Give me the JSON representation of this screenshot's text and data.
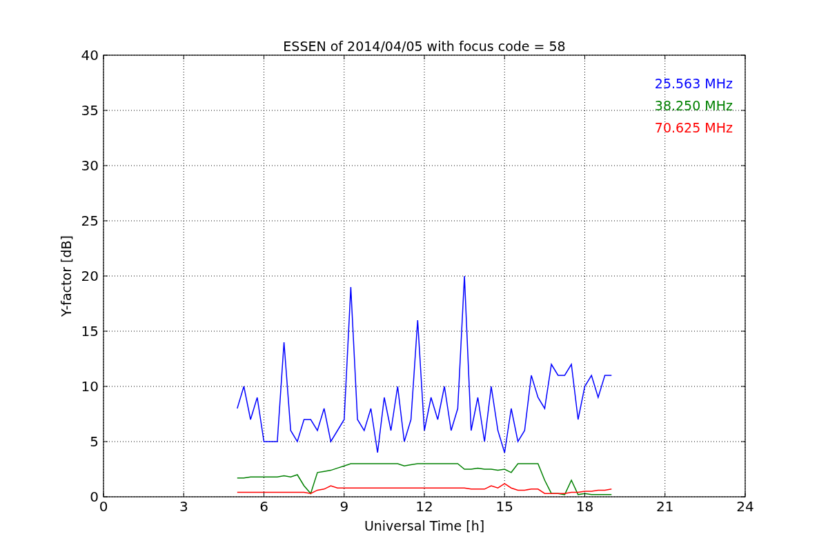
{
  "chart_data": {
    "type": "line",
    "title": "ESSEN of 2014/04/05 with focus code = 58",
    "xlabel": "Universal Time [h]",
    "ylabel": "Y-factor [dB]",
    "x": [
      5,
      5.25,
      5.5,
      5.75,
      6,
      6.25,
      6.5,
      6.75,
      7,
      7.25,
      7.5,
      7.75,
      8,
      8.25,
      8.5,
      8.75,
      9,
      9.25,
      9.5,
      9.75,
      10,
      10.25,
      10.5,
      10.75,
      11,
      11.25,
      11.5,
      11.75,
      12,
      12.25,
      12.5,
      12.75,
      13,
      13.25,
      13.5,
      13.75,
      14,
      14.25,
      14.5,
      14.75,
      15,
      15.25,
      15.5,
      15.75,
      16,
      16.25,
      16.5,
      16.75,
      17,
      17.25,
      17.5,
      17.75,
      18,
      18.25,
      18.5,
      18.75,
      19
    ],
    "series": [
      {
        "name": "25.563 MHz",
        "color": "#0000ff",
        "values": [
          8,
          10,
          7,
          9,
          5,
          5,
          5,
          14,
          6,
          5,
          7,
          7,
          6,
          8,
          5,
          6,
          7,
          19,
          7,
          6,
          8,
          4,
          9,
          6,
          10,
          5,
          7,
          16,
          6,
          9,
          7,
          10,
          6,
          8,
          20,
          6,
          9,
          5,
          10,
          6,
          4,
          8,
          5,
          6,
          11,
          9,
          8,
          12,
          11,
          11,
          12,
          7,
          10,
          11,
          9,
          11,
          11
        ]
      },
      {
        "name": "38.250 MHz",
        "color": "#008000",
        "values": [
          1.7,
          1.7,
          1.8,
          1.8,
          1.8,
          1.8,
          1.8,
          1.9,
          1.8,
          2.0,
          1.0,
          0.3,
          2.2,
          2.3,
          2.4,
          2.6,
          2.8,
          3.0,
          3.0,
          3.0,
          3.0,
          3.0,
          3.0,
          3.0,
          3.0,
          2.8,
          2.9,
          3.0,
          3.0,
          3.0,
          3.0,
          3.0,
          3.0,
          3.0,
          2.5,
          2.5,
          2.6,
          2.5,
          2.5,
          2.4,
          2.5,
          2.2,
          3.0,
          3.0,
          3.0,
          3.0,
          1.5,
          0.3,
          0.3,
          0.2,
          1.5,
          0.2,
          0.3,
          0.2,
          0.2,
          0.2,
          0.2
        ]
      },
      {
        "name": "70.625 MHz",
        "color": "#ff0000",
        "values": [
          0.4,
          0.4,
          0.4,
          0.4,
          0.4,
          0.4,
          0.4,
          0.4,
          0.4,
          0.4,
          0.4,
          0.3,
          0.6,
          0.7,
          1.0,
          0.8,
          0.8,
          0.8,
          0.8,
          0.8,
          0.8,
          0.8,
          0.8,
          0.8,
          0.8,
          0.8,
          0.8,
          0.8,
          0.8,
          0.8,
          0.8,
          0.8,
          0.8,
          0.8,
          0.8,
          0.7,
          0.7,
          0.7,
          1.0,
          0.8,
          1.2,
          0.8,
          0.6,
          0.6,
          0.7,
          0.7,
          0.3,
          0.3,
          0.3,
          0.3,
          0.4,
          0.4,
          0.5,
          0.5,
          0.6,
          0.6,
          0.7
        ]
      }
    ],
    "grid": true,
    "xlim": [
      0,
      24
    ],
    "ylim": [
      0,
      40
    ],
    "xticks": [
      0,
      3,
      6,
      9,
      12,
      15,
      18,
      21,
      24
    ],
    "yticks": [
      0,
      5,
      10,
      15,
      20,
      25,
      30,
      35,
      40
    ]
  }
}
